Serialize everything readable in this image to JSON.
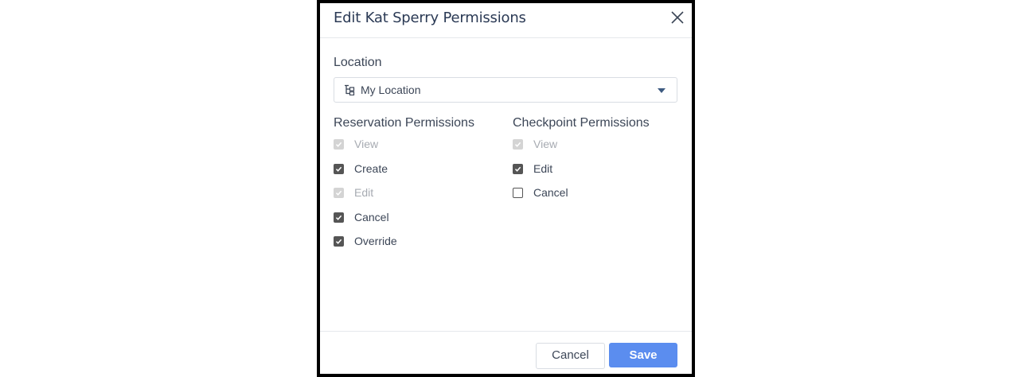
{
  "dialog": {
    "title": "Edit Kat Sperry Permissions",
    "close_icon": "close-icon"
  },
  "location": {
    "label": "Location",
    "selected": "My Location",
    "icon": "location-tree-icon"
  },
  "reservation": {
    "title": "Reservation Permissions",
    "items": [
      {
        "label": "View",
        "checked": true,
        "disabled": true
      },
      {
        "label": "Create",
        "checked": true,
        "disabled": false
      },
      {
        "label": "Edit",
        "checked": true,
        "disabled": true
      },
      {
        "label": "Cancel",
        "checked": true,
        "disabled": false
      },
      {
        "label": "Override",
        "checked": true,
        "disabled": false
      }
    ]
  },
  "checkpoint": {
    "title": "Checkpoint Permissions",
    "items": [
      {
        "label": "View",
        "checked": true,
        "disabled": true
      },
      {
        "label": "Edit",
        "checked": true,
        "disabled": false
      },
      {
        "label": "Cancel",
        "checked": false,
        "disabled": false
      }
    ]
  },
  "footer": {
    "cancel_label": "Cancel",
    "save_label": "Save"
  },
  "colors": {
    "primary": "#5b8def",
    "title": "#2b3a55",
    "checked": "#555555",
    "disabled": "#d4d4d4"
  }
}
